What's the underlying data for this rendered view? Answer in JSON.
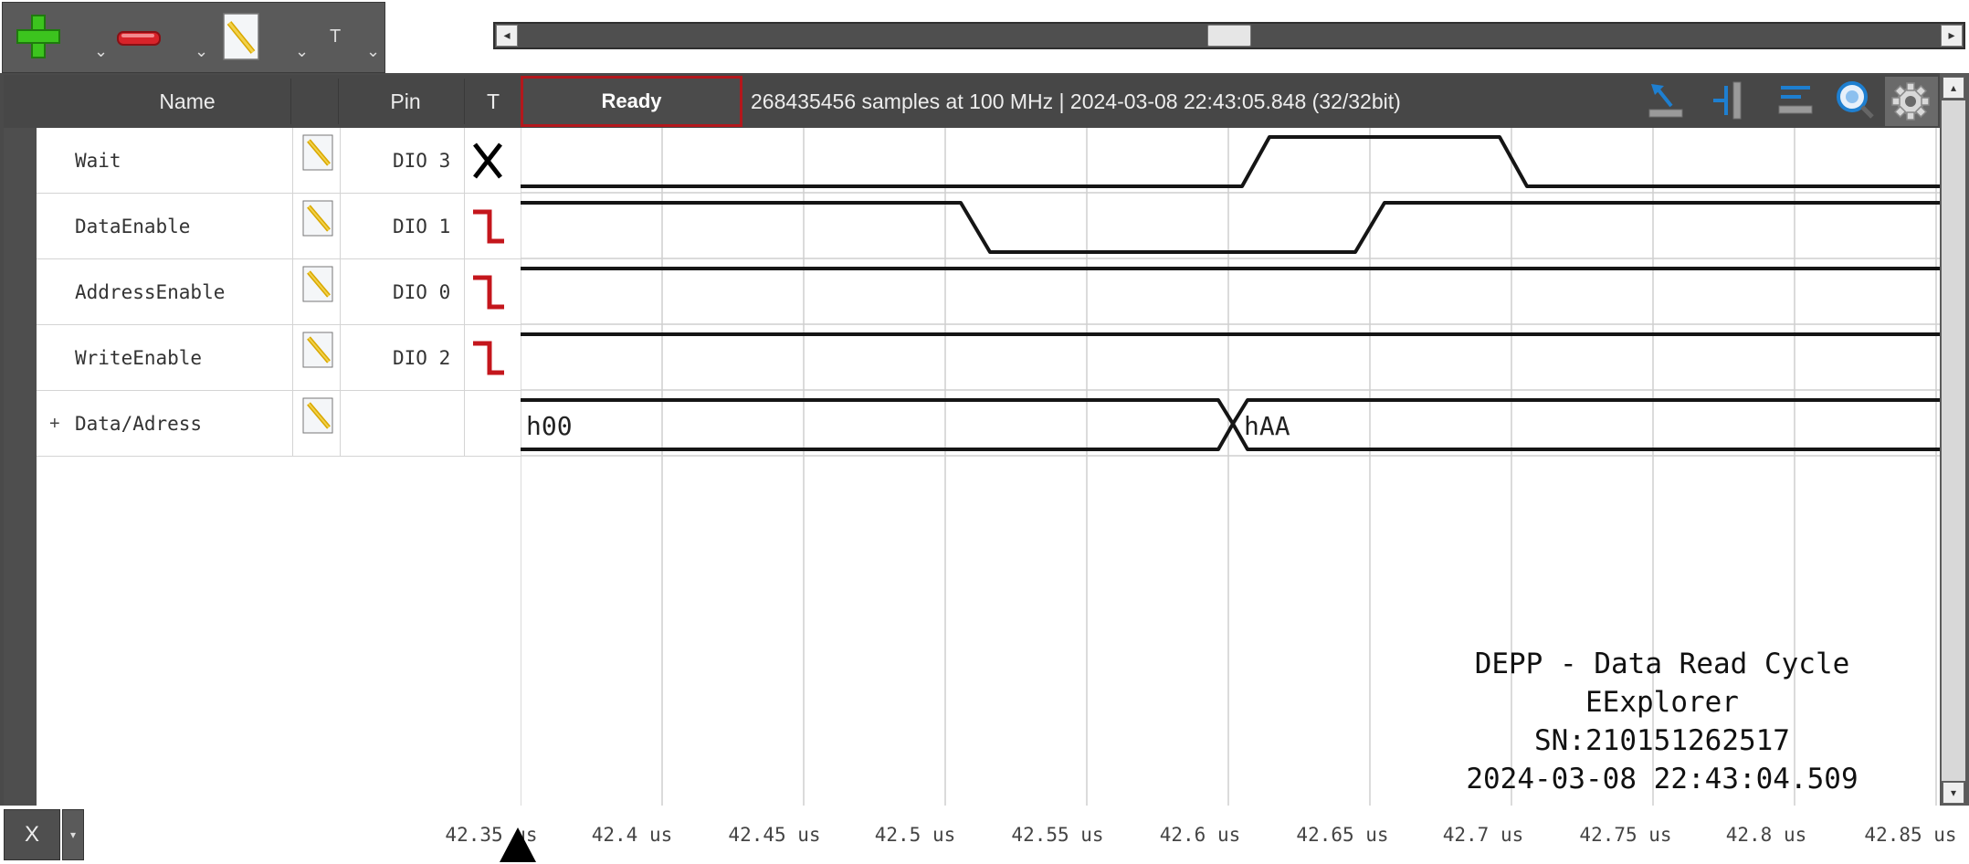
{
  "toolbar": {
    "add_icon": "plus-icon",
    "remove_icon": "minus-icon",
    "edit_icon": "pencil-icon",
    "text_label": "T",
    "caret": "⌄"
  },
  "header": {
    "name_label": "Name",
    "pin_label": "Pin",
    "trigger_label": "T",
    "status": "Ready",
    "info": "268435456 samples at 100 MHz | 2024-03-08 22:43:05.848 (32/32bit)"
  },
  "signals": [
    {
      "name": "Wait",
      "pin": "DIO  3",
      "trigger": "either-edge"
    },
    {
      "name": "DataEnable",
      "pin": "DIO  1",
      "trigger": "falling-edge"
    },
    {
      "name": "AddressEnable",
      "pin": "DIO  0",
      "trigger": "falling-edge"
    },
    {
      "name": "WriteEnable",
      "pin": "DIO  2",
      "trigger": "falling-edge"
    },
    {
      "name": "Data/Adress",
      "pin": "",
      "trigger": "none",
      "expand": "+"
    }
  ],
  "bus_values": [
    "h00",
    "hAA"
  ],
  "watermark": {
    "line1": "DEPP - Data Read Cycle",
    "line2": "EExplorer",
    "line3": "SN:210151262517",
    "line4": "2024-03-08 22:43:04.509"
  },
  "axis": {
    "button_label": "X",
    "ticks": [
      "42.35 us",
      "42.4 us",
      "42.45 us",
      "42.5 us",
      "42.55 us",
      "42.6 us",
      "42.65 us",
      "42.7 us",
      "42.75 us",
      "42.8 us",
      "42.85 us"
    ]
  },
  "colors": {
    "trigger_red": "#c4161c",
    "status_border": "#b3171c",
    "toolbar_bg": "#5a5a5a",
    "add_green": "#3cc41e",
    "remove_red": "#d8232a",
    "tool_blue": "#1e7fd0"
  }
}
